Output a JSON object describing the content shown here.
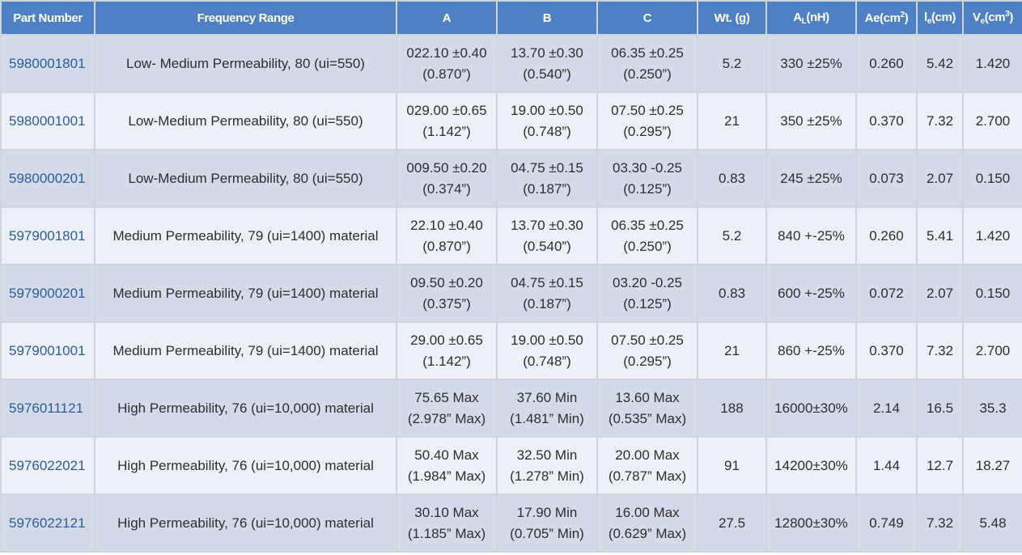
{
  "headers": {
    "part_number": "Part Number",
    "frequency_range": "Frequency Range",
    "a": "A",
    "b": "B",
    "c": "C",
    "weight": "Wt. (g)",
    "al_main": "A",
    "al_sub": "L",
    "al_unit": "(nH)",
    "ae_main": "Ae(cm",
    "ae_sup": "2",
    "ae_close": ")",
    "le_main": "l",
    "le_sub": "e",
    "le_unit": "(cm)",
    "ve_main": "V",
    "ve_sub": "e",
    "ve_unit": "(cm",
    "ve_sup": "3",
    "ve_close": ")"
  },
  "rows": [
    {
      "part": "5980001801",
      "freq": "Low- Medium Permeability, 80 (ui=550)",
      "a1": "022.10 ±0.40",
      "a2": "(0.870”)",
      "b1": "13.70 ±0.30",
      "b2": "(0.540”)",
      "c1": "06.35 ±0.25",
      "c2": "(0.250”)",
      "wt": "5.2",
      "al": "330 ±25%",
      "ae": "0.260",
      "le": "5.42",
      "ve": "1.420"
    },
    {
      "part": "5980001001",
      "freq": "Low-Medium Permeability, 80 (ui=550)",
      "a1": "029.00 ±0.65",
      "a2": "(1.142”)",
      "b1": "19.00 ±0.50",
      "b2": "(0.748”)",
      "c1": "07.50 ±0.25",
      "c2": "(0.295”)",
      "wt": "21",
      "al": "350 ±25%",
      "ae": "0.370",
      "le": "7.32",
      "ve": "2.700"
    },
    {
      "part": "5980000201",
      "freq": "Low-Medium Permeability, 80 (ui=550)",
      "a1": "009.50 ±0.20",
      "a2": "(0.374”)",
      "b1": "04.75 ±0.15",
      "b2": "(0.187”)",
      "c1": "03.30 -0.25",
      "c2": "(0.125”)",
      "wt": "0.83",
      "al": "245 ±25%",
      "ae": "0.073",
      "le": "2.07",
      "ve": "0.150"
    },
    {
      "part": "5979001801",
      "freq": "Medium Permeability, 79 (ui=1400) material",
      "a1": "22.10 ±0.40",
      "a2": "(0.870”)",
      "b1": "13.70 ±0.30",
      "b2": "(0.540”)",
      "c1": "06.35 ±0.25",
      "c2": "(0.250”)",
      "wt": "5.2",
      "al": "840 +-25%",
      "ae": "0.260",
      "le": "5.41",
      "ve": "1.420"
    },
    {
      "part": "5979000201",
      "freq": "Medium Permeability, 79 (ui=1400) material",
      "a1": "09.50 ±0.20",
      "a2": "(0.375”)",
      "b1": "04.75 ±0.15",
      "b2": "(0.187”)",
      "c1": "03.20 -0.25",
      "c2": "(0.125”)",
      "wt": "0.83",
      "al": "600 +-25%",
      "ae": "0.072",
      "le": "2.07",
      "ve": "0.150"
    },
    {
      "part": "5979001001",
      "freq": "Medium Permeability, 79 (ui=1400) material",
      "a1": "29.00 ±0.65",
      "a2": "(1.142”)",
      "b1": "19.00 ±0.50",
      "b2": "(0.748”)",
      "c1": "07.50 ±0.25",
      "c2": "(0.295”)",
      "wt": "21",
      "al": "860 +-25%",
      "ae": "0.370",
      "le": "7.32",
      "ve": "2.700"
    },
    {
      "part": "5976011121",
      "freq": "High Permeability, 76 (ui=10,000) material",
      "a1": "75.65 Max",
      "a2": "(2.978” Max)",
      "b1": "37.60 Min",
      "b2": "(1.481” Min)",
      "c1": "13.60 Max",
      "c2": "(0.535” Max)",
      "wt": "188",
      "al": "16000±30%",
      "ae": "2.14",
      "le": "16.5",
      "ve": "35.3"
    },
    {
      "part": "5976022021",
      "freq": "High Permeability, 76 (ui=10,000) material",
      "a1": "50.40 Max",
      "a2": "(1.984” Max)",
      "b1": "32.50 Min",
      "b2": "(1.278” Min)",
      "c1": "20.00 Max",
      "c2": "(0.787” Max)",
      "wt": "91",
      "al": "14200±30%",
      "ae": "1.44",
      "le": "12.7",
      "ve": "18.27"
    },
    {
      "part": "5976022121",
      "freq": "High Permeability, 76 (ui=10,000) material",
      "a1": "30.10 Max",
      "a2": "(1.185” Max)",
      "b1": "17.90 Min",
      "b2": "(0.705” Min)",
      "c1": "16.00 Max",
      "c2": "(0.629” Max)",
      "wt": "27.5",
      "al": "12800±30%",
      "ae": "0.749",
      "le": "7.32",
      "ve": "5.48"
    }
  ]
}
